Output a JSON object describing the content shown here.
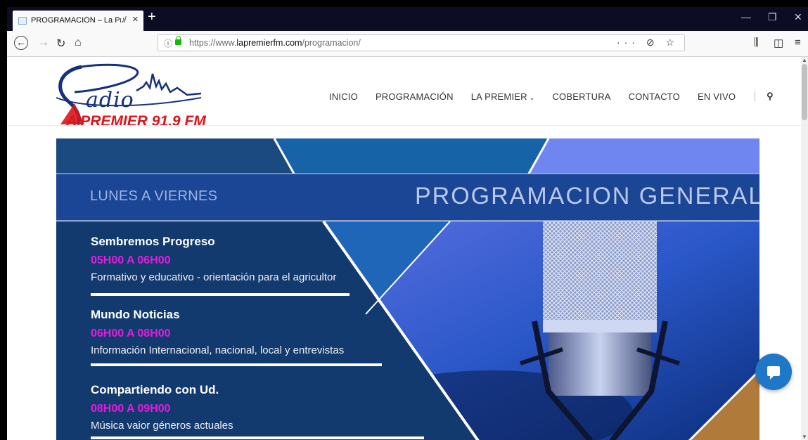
{
  "browser": {
    "tab_title": "PROGRAMACIÓN – La Premier",
    "new_tab_label": "+",
    "url_protocol": "https://www.",
    "url_domain": "lapremierfm.com",
    "url_path": "/programacion/",
    "url_actions": "··· ⊘ ☆",
    "window_controls": [
      "—",
      "❐",
      "✕"
    ]
  },
  "site": {
    "logo_word": "adio",
    "logo_sub": "A PREMIER 91.9 FM",
    "nav": [
      {
        "label": "INICIO"
      },
      {
        "label": "PROGRAMACIÓN"
      },
      {
        "label": "LA PREMIER",
        "caret": "⌄"
      },
      {
        "label": "COBERTURA"
      },
      {
        "label": "CONTACTO"
      },
      {
        "label": "EN VIVO"
      }
    ]
  },
  "banner": {
    "days_label": "LUNES A VIERNES",
    "title": "PROGRAMACION GENERAL",
    "programs": [
      {
        "name": "Sembremos Progreso",
        "time": "05H00 A 06H00",
        "description": "Formativo y educativo - orientación para el agricultor"
      },
      {
        "name": "Mundo Noticias",
        "time": "06H00 A 08H00",
        "description": "Información Internacional, nacional, local y entrevistas"
      },
      {
        "name": "Compartiendo con Ud.",
        "time": "08H00 A 09H00",
        "description": "Música vaior géneros actuales"
      }
    ]
  },
  "colors": {
    "accent_magenta": "#e81ae0",
    "banner_navy": "#123a6e",
    "logo_red": "#d9151c",
    "logo_blue": "#16307a",
    "chat_blue": "#1f78c7"
  }
}
